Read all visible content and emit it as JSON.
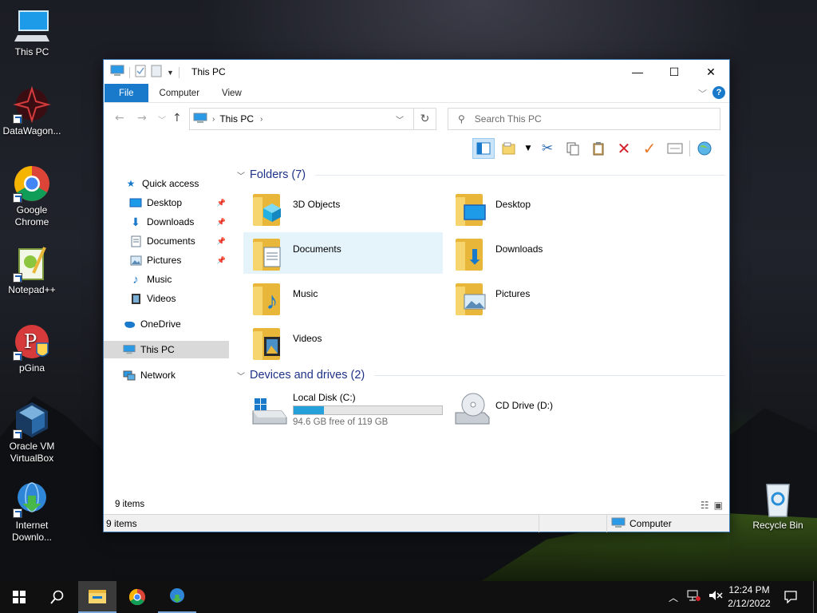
{
  "desktop": {
    "icons": [
      {
        "label": "This PC"
      },
      {
        "label": "DataWagon..."
      },
      {
        "label": "Google Chrome"
      },
      {
        "label": "Notepad++"
      },
      {
        "label": "pGina"
      },
      {
        "label": "Oracle VM VirtualBox"
      },
      {
        "label": "Internet Downlo..."
      },
      {
        "label": "Recycle Bin"
      }
    ]
  },
  "window": {
    "title": "This PC",
    "ribbon_tabs": [
      "File",
      "Computer",
      "View"
    ],
    "address": {
      "location": "This PC"
    },
    "search": {
      "placeholder": "Search This PC"
    },
    "nav": {
      "quick_access": "Quick access",
      "items": [
        "Desktop",
        "Downloads",
        "Documents",
        "Pictures",
        "Music",
        "Videos"
      ],
      "onedrive": "OneDrive",
      "this_pc": "This PC",
      "network": "Network"
    },
    "folders_header": "Folders (7)",
    "folders": [
      "3D Objects",
      "Desktop",
      "Documents",
      "Downloads",
      "Music",
      "Pictures",
      "Videos"
    ],
    "devices_header": "Devices and drives (2)",
    "drives": [
      {
        "name": "Local Disk (C:)",
        "free_text": "94.6 GB free of 119 GB",
        "used_fraction": 0.205
      },
      {
        "name": "CD Drive (D:)"
      }
    ],
    "item_count": "9 items",
    "status": {
      "left": "9 items",
      "right": "Computer"
    }
  },
  "taskbar": {
    "time": "12:24 PM",
    "date": "2/12/2022"
  },
  "colors": {
    "accent": "#1979ca",
    "header_text": "#1e3287",
    "selection": "#e5f3fb"
  }
}
